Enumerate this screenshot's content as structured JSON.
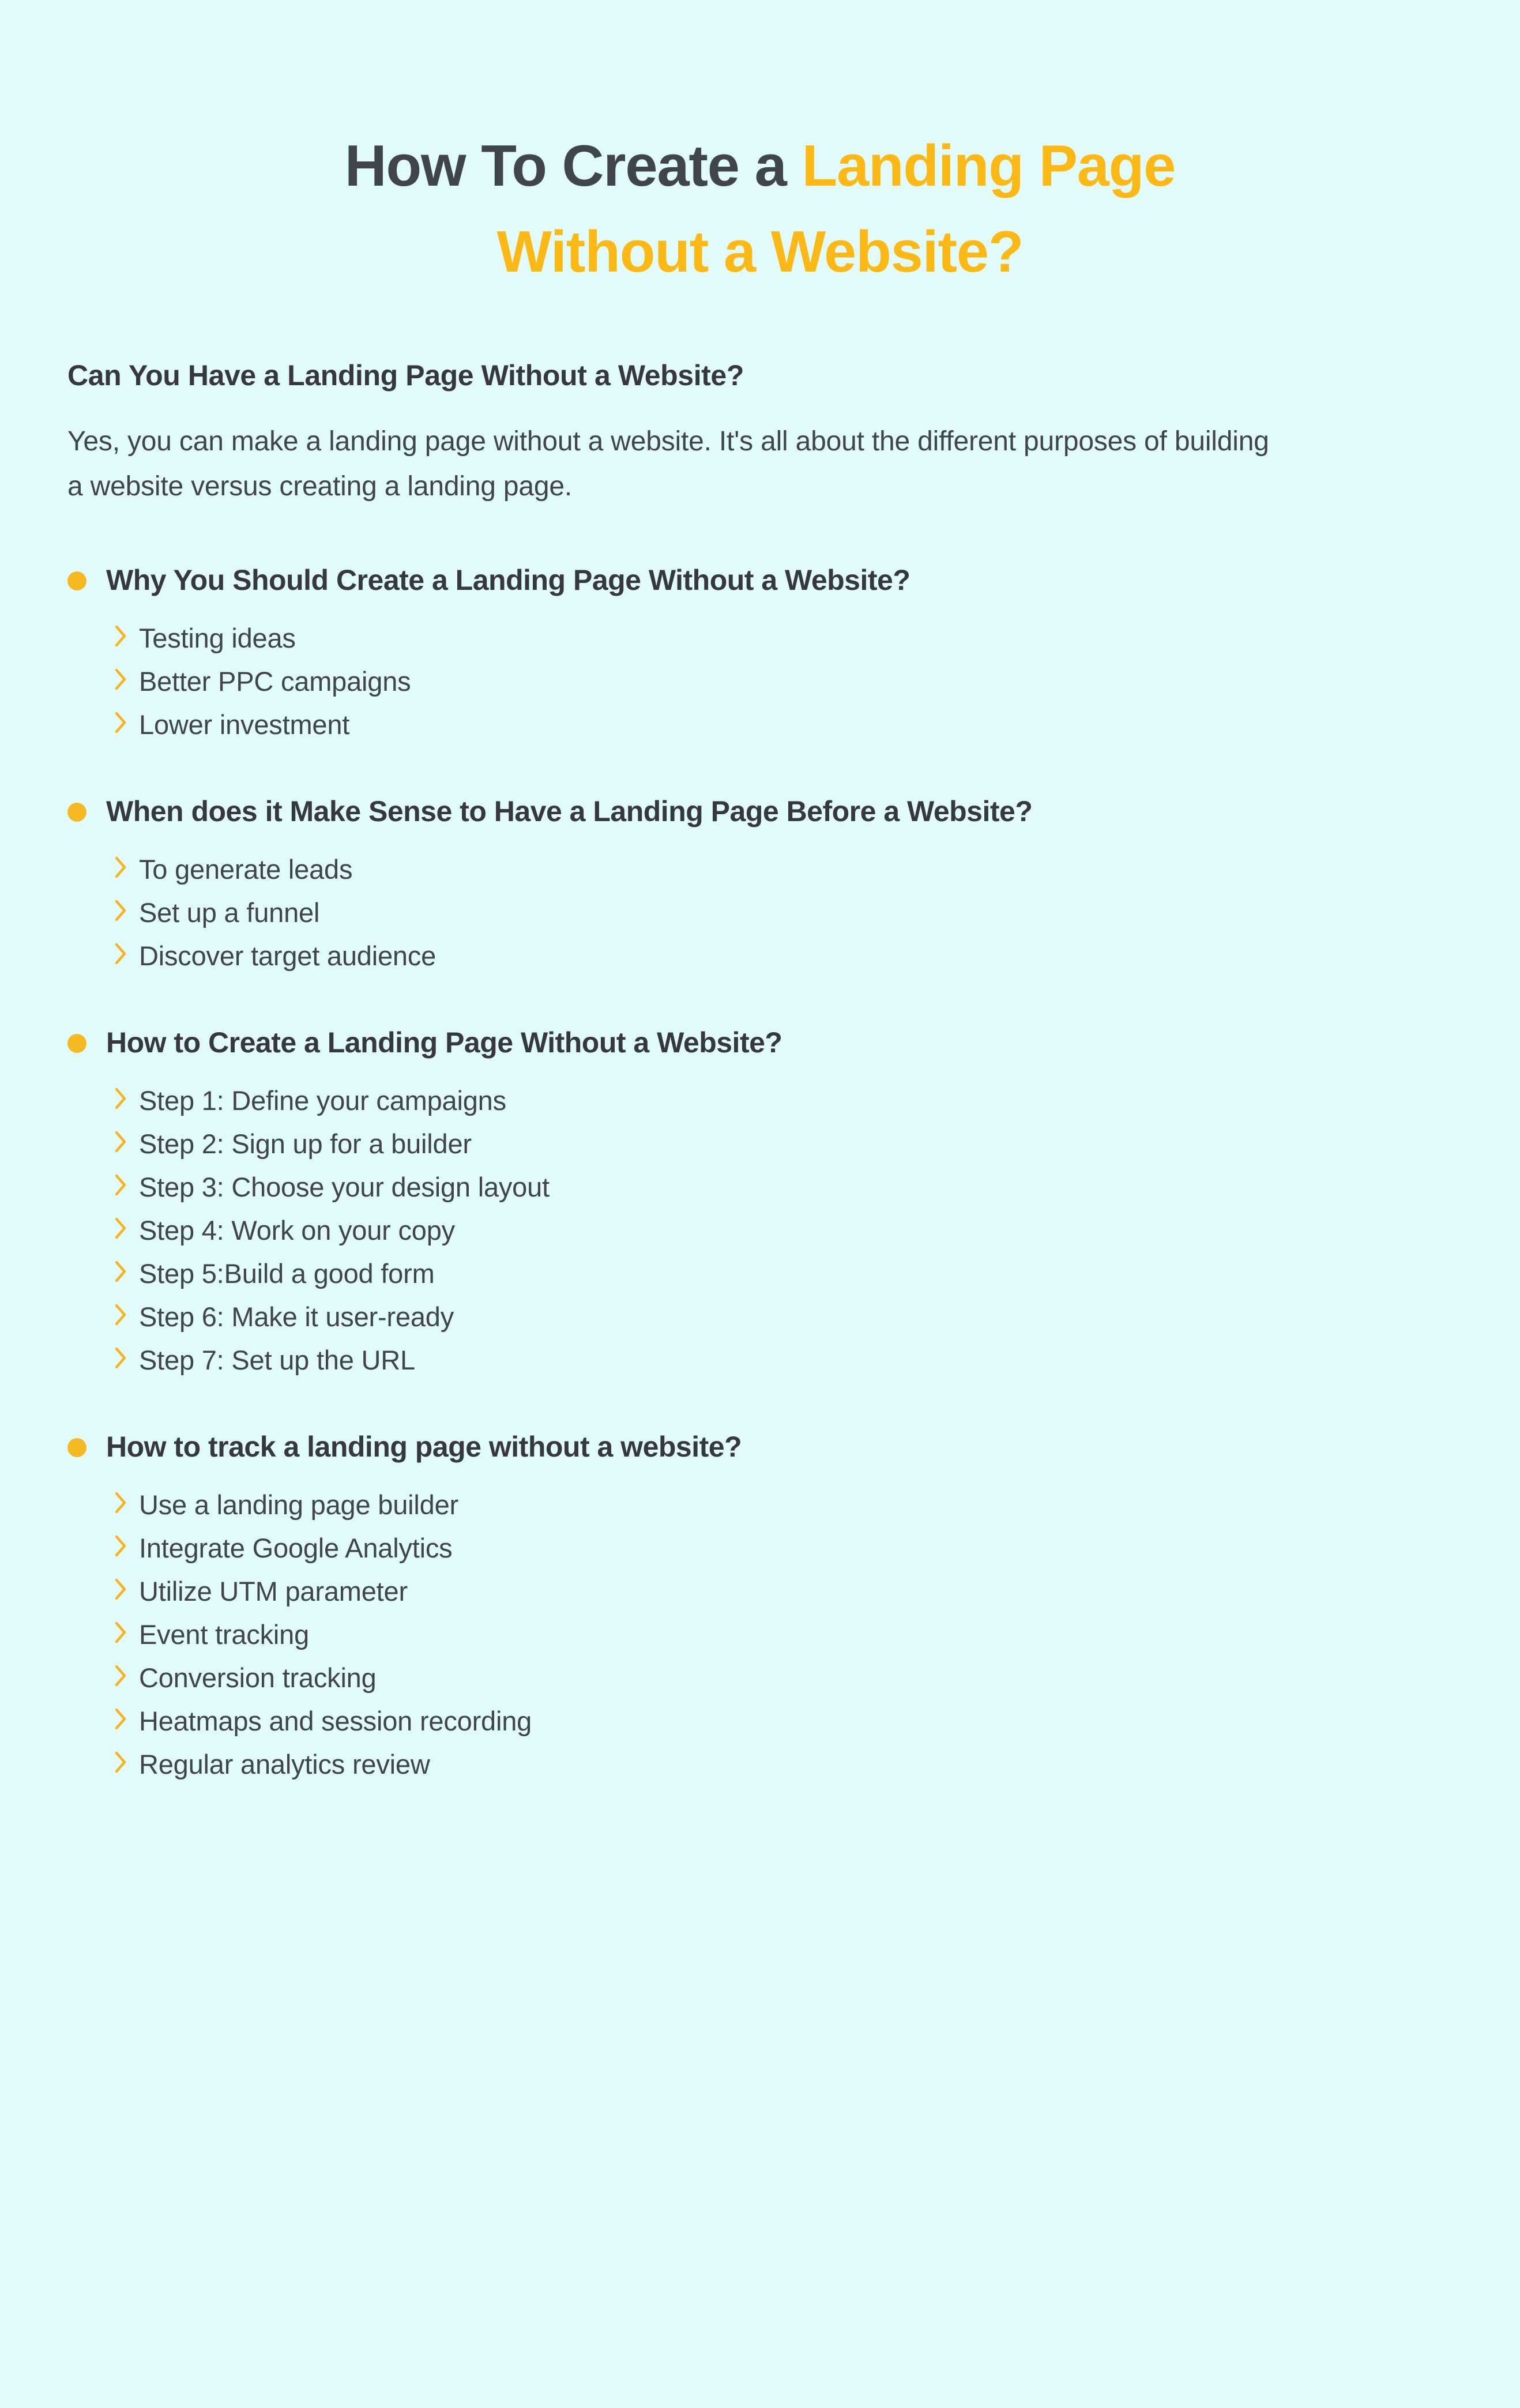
{
  "theme": {
    "background": "#e1fafa",
    "text_dark": "#3f4548",
    "accent_amber": "#fcb814",
    "bullet_amber": "#f5b921",
    "chevron_amber": "#f7b320"
  },
  "title": {
    "line1_dark": "How To Create a ",
    "line1_amber": "Landing Page",
    "line2_amber": "Without a Website?"
  },
  "intro": {
    "heading": "Can You Have a Landing Page Without a Website?",
    "paragraph": "Yes, you can make a landing page without a website. It's all about the different purposes of building a website versus creating a landing page."
  },
  "sections": [
    {
      "heading": "Why You Should Create a Landing Page Without a Website?",
      "items": [
        "Testing ideas",
        "Better PPC campaigns",
        "Lower investment"
      ]
    },
    {
      "heading": "When does it Make Sense to Have a Landing Page Before a Website?",
      "items": [
        "To generate leads",
        "Set up a funnel",
        "Discover target audience"
      ]
    },
    {
      "heading": "How to Create a Landing Page Without a Website?",
      "items": [
        "Step 1: Define your campaigns",
        "Step 2: Sign up for a builder",
        "Step 3: Choose your design layout",
        "Step 4: Work on your copy",
        "Step 5:Build a good form",
        "Step 6: Make it user-ready",
        "Step 7: Set up the URL"
      ]
    },
    {
      "heading": "How to track a landing page without a website?",
      "items": [
        "Use a landing page builder",
        "Integrate Google Analytics",
        "Utilize UTM parameter",
        "Event tracking",
        "Conversion tracking",
        "Heatmaps and session recording",
        "Regular analytics review"
      ]
    }
  ]
}
